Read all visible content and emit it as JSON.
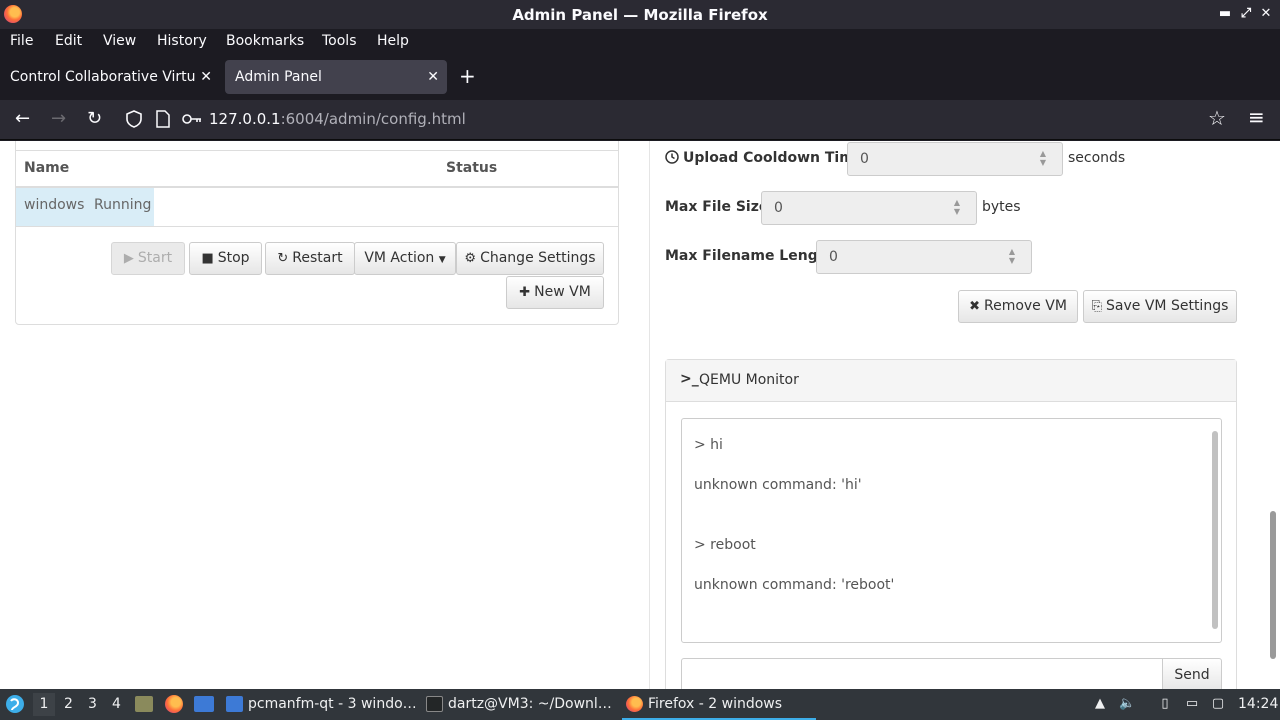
{
  "window": {
    "title": "Admin Panel — Mozilla Firefox",
    "minimize": "▬",
    "maximize": "⤢",
    "close": "✕"
  },
  "menu": [
    "File",
    "Edit",
    "View",
    "History",
    "Bookmarks",
    "Tools",
    "Help"
  ],
  "tabs": [
    {
      "label": "Control Collaborative Virtual",
      "close": "✕"
    },
    {
      "label": "Admin Panel",
      "close": "✕"
    }
  ],
  "new_tab": "+",
  "nav": {
    "back": "←",
    "forward": "→",
    "reload": "↻",
    "bookmark": "☆",
    "menu": "≡",
    "url_host": "127.0.0.1",
    "url_rest": ":6004/admin/config.html"
  },
  "vm_table": {
    "headers": [
      "Name",
      "Status"
    ],
    "rows": [
      {
        "name": "windows",
        "status": "Running"
      }
    ]
  },
  "vm_buttons": {
    "start": "Start",
    "stop": "Stop",
    "restart": "Restart",
    "vm_action": "VM Action",
    "change_settings": "Change Settings",
    "new_vm": "New VM"
  },
  "settings": {
    "upload_cooldown": {
      "label": "Upload Cooldown Time:",
      "value": "0",
      "unit": "seconds"
    },
    "max_file_size": {
      "label": "Max File Size:",
      "value": "0",
      "unit": "bytes"
    },
    "max_filename_length": {
      "label": "Max Filename Length:",
      "value": "0"
    },
    "remove_vm": "Remove VM",
    "save_vm_settings": "Save VM Settings"
  },
  "qemu": {
    "title": "QEMU Monitor",
    "lines": [
      "> hi",
      "unknown command: 'hi'",
      "> reboot",
      "unknown command: 'reboot'"
    ],
    "input_value": "",
    "send": "Send"
  },
  "taskbar": {
    "workspaces": [
      "1",
      "2",
      "3",
      "4"
    ],
    "items": [
      {
        "label": "pcmanfm-qt - 3 windo…"
      },
      {
        "label": "dartz@VM3: ~/Downl…"
      },
      {
        "label": "Firefox - 2 windows"
      }
    ],
    "clock": "14:24"
  },
  "colors": {
    "accent": "#3daee9",
    "firefox_dark": "#1c1b22",
    "row_info": "#d9edf7"
  }
}
